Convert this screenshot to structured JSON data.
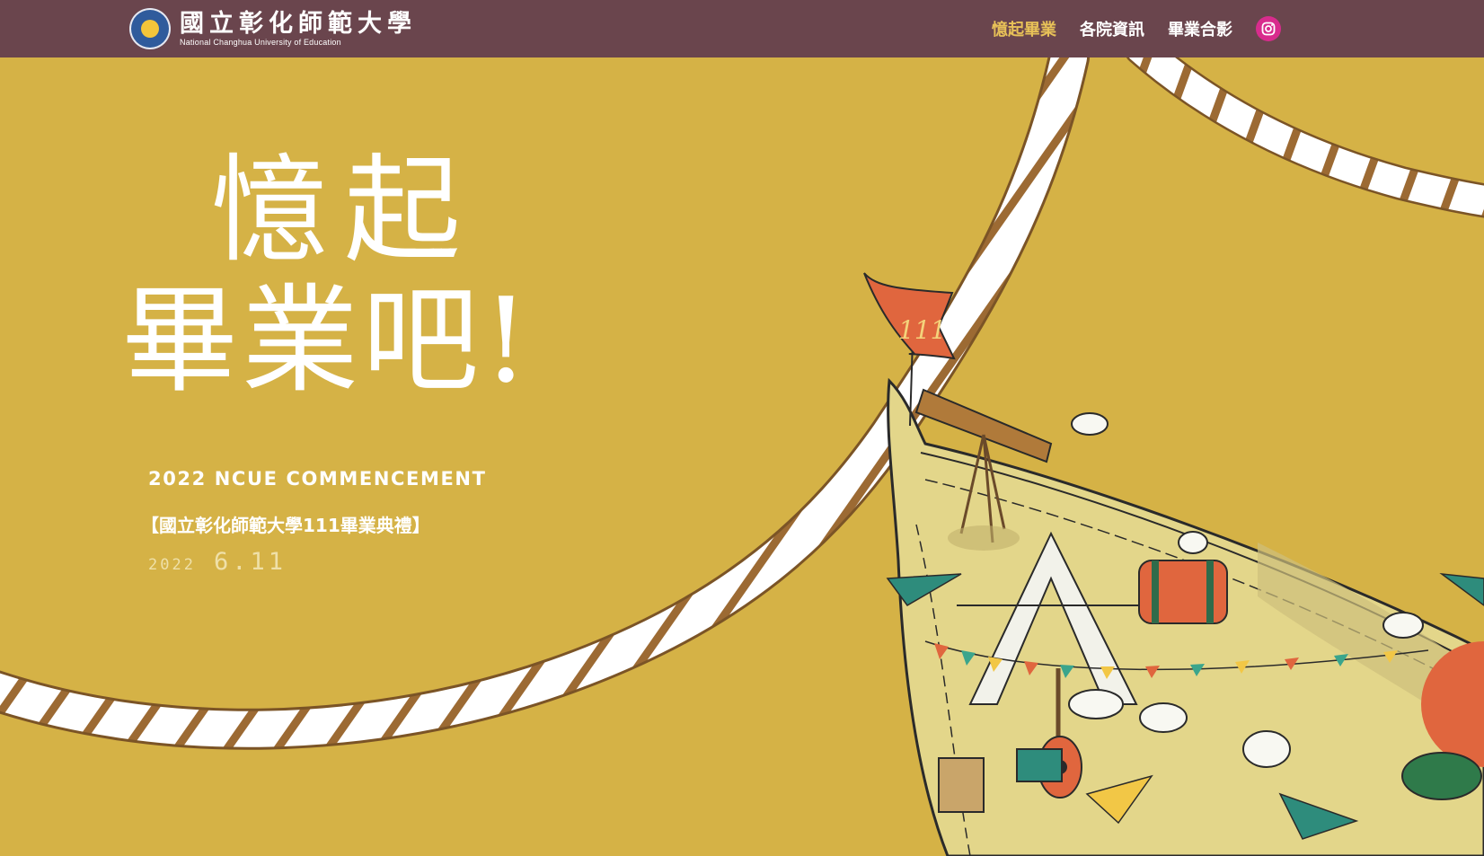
{
  "header": {
    "logo_zh": "國立彰化師範大學",
    "logo_en": "National Changhua University of Education",
    "nav": [
      {
        "label": "憶起畢業",
        "active": true
      },
      {
        "label": "各院資訊",
        "active": false
      },
      {
        "label": "畢業合影",
        "active": false
      }
    ],
    "instagram_icon": "instagram-icon"
  },
  "hero": {
    "headline_line1": "憶起",
    "headline_line2": "畢業吧!",
    "subtitle_en": "2022 NCUE COMMENCEMENT",
    "subtitle_zh": "【國立彰化師範大學111畢業典禮】",
    "date_year": "2022",
    "date_day": "6.11",
    "flag_number": "111"
  },
  "colors": {
    "navbar_bg": "#6a454d",
    "hero_bg": "#d5b246",
    "nav_active": "#e7c158",
    "flag": "#e0663e"
  }
}
